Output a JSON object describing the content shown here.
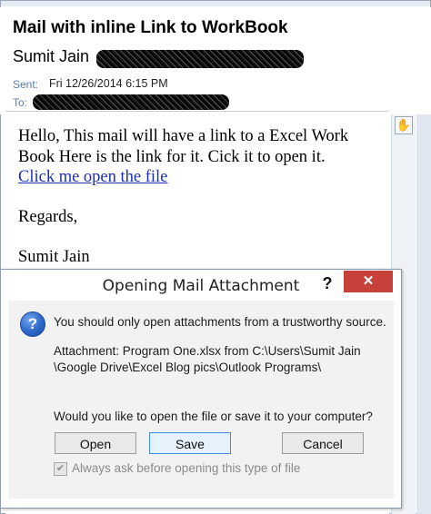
{
  "mail": {
    "subject": "Mail with inline Link to WorkBook",
    "sender_name": "Sumit Jain",
    "sent_label": "Sent:",
    "sent_value": "Fri 12/26/2014 6:15 PM",
    "to_label": "To:"
  },
  "body": {
    "line1": "Hello, This mail will have a link to a Excel Work",
    "line2": "Book Here is the link for it. Cick it to open it.",
    "link_text": "Click me open the file",
    "regards": "Regards,",
    "signature": "Sumit Jain"
  },
  "dialog": {
    "title": "Opening Mail Attachment",
    "help_label": "?",
    "close_label": "✕",
    "warning": "You should only open attachments from a trustworthy source.",
    "attachment_line1": "Attachment: Program One.xlsx from C:\\Users\\Sumit Jain",
    "attachment_line2": "\\Google Drive\\Excel Blog pics\\Outlook Programs\\",
    "question": "Would you like to open the file or save it to your computer?",
    "open_label": "Open",
    "save_label": "Save",
    "cancel_label": "Cancel",
    "checkbox_label": "Always ask before opening this type of file",
    "checkbox_checked": true
  },
  "icons": {
    "info": "question-icon",
    "scroll": "hand-icon"
  },
  "colors": {
    "close_button": "#c7403a",
    "link": "#1a2fb5",
    "meta_label": "#5a7fb5"
  }
}
